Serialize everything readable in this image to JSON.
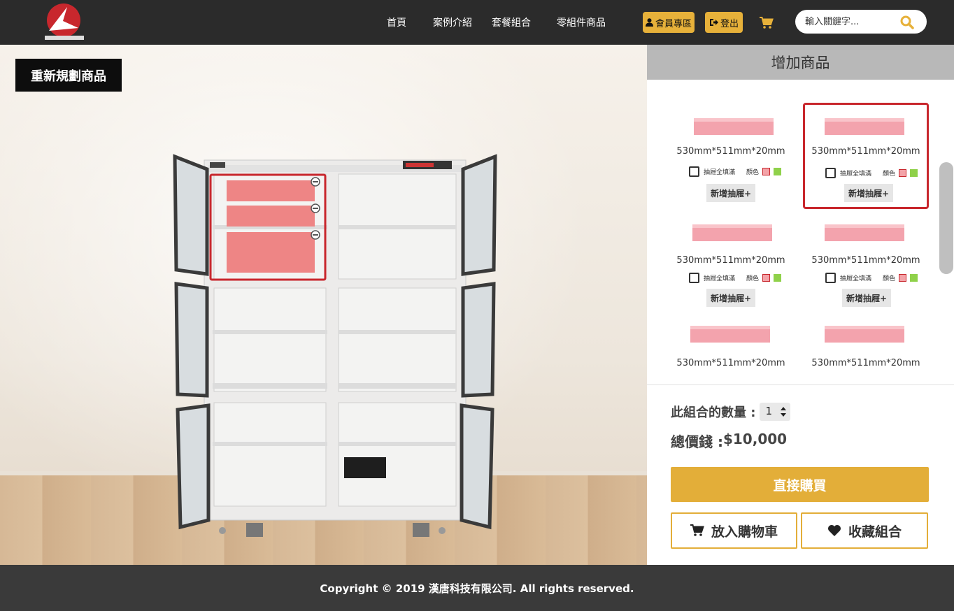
{
  "header": {
    "nav": [
      "首頁",
      "案例介紹",
      "套餐組合",
      "零組件商品"
    ],
    "member_label": "會員專區",
    "logout_label": "登出",
    "search_placeholder": "輸入關鍵字..."
  },
  "scene": {
    "replan_label": "重新規劃商品"
  },
  "panel": {
    "title": "增加商品",
    "products": [
      {
        "dimension": "530mm*511mm*20mm",
        "fill_label": "抽屜全填滿",
        "color_label": "顏色",
        "add_label": "新增抽屜+",
        "selected": false
      },
      {
        "dimension": "530mm*511mm*20mm",
        "fill_label": "抽屜全填滿",
        "color_label": "顏色",
        "add_label": "新增抽屜+",
        "selected": true
      },
      {
        "dimension": "530mm*511mm*20mm",
        "fill_label": "抽屜全填滿",
        "color_label": "顏色",
        "add_label": "新增抽屜+",
        "selected": false
      },
      {
        "dimension": "530mm*511mm*20mm",
        "fill_label": "抽屜全填滿",
        "color_label": "顏色",
        "add_label": "新增抽屜+",
        "selected": false
      },
      {
        "dimension": "530mm*511mm*20mm"
      },
      {
        "dimension": "530mm*511mm*20mm"
      }
    ],
    "quantity_label": "此組合的數量 :",
    "quantity_value": "1",
    "total_label": "總價錢 : ",
    "total_value": "$10,000",
    "buy_label": "直接購買",
    "cart_label": "放入購物車",
    "favorite_label": "收藏組合"
  },
  "footer": {
    "copyright": "Copyright © 2019 漢唐科技有限公司. All rights reserved."
  },
  "colors": {
    "accent": "#e3ae39",
    "header_bg": "#2b2b2b",
    "selected_border": "#c8272d",
    "drawer_red": "#f3a3a8",
    "drawer_green": "#8fd14a"
  }
}
